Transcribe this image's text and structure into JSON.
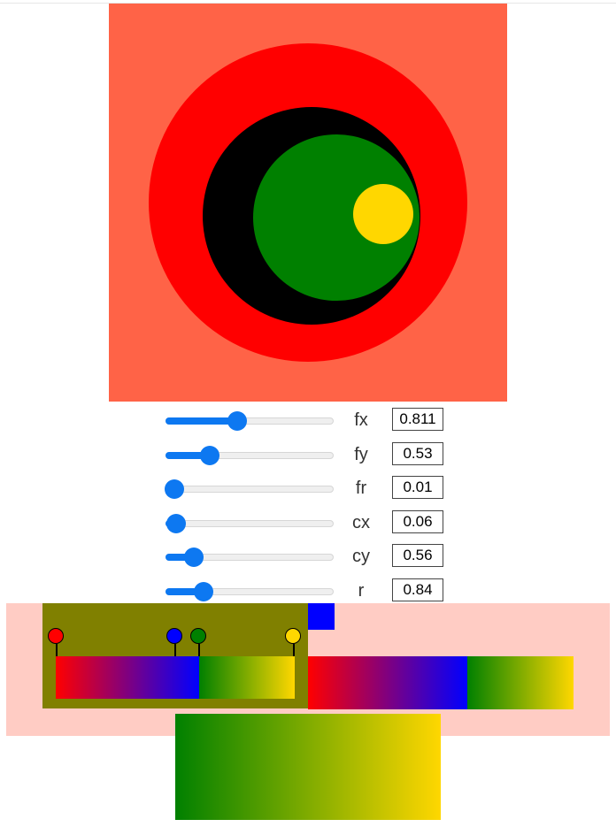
{
  "colors": {
    "background": "#ff6347",
    "ring_outer": "#ff0000",
    "ring_dark": "#000000",
    "ring_green": "#008000",
    "ring_gold": "#ffd700",
    "slider_accent": "#0d78f1",
    "editor_bg": "#ffccc4",
    "editor_panel": "#808000",
    "stop_red": "#ff0000",
    "stop_blue": "#0000ff",
    "stop_green": "#008000",
    "stop_yellow": "#ffd700"
  },
  "controls": [
    {
      "name": "fx",
      "label": "fx",
      "value": "0.811",
      "level": 0.41
    },
    {
      "name": "fy",
      "label": "fy",
      "value": "0.53",
      "level": 0.23
    },
    {
      "name": "fr",
      "label": "fr",
      "value": "0.01",
      "level": 0.0
    },
    {
      "name": "cx",
      "label": "cx",
      "value": "0.06",
      "level": 0.01
    },
    {
      "name": "cy",
      "label": "cy",
      "value": "0.56",
      "level": 0.13
    },
    {
      "name": "r",
      "label": "r",
      "value": "0.84",
      "level": 0.19
    }
  ],
  "gradient_stops": [
    {
      "color": "#ff0000",
      "offset": 0.0
    },
    {
      "color": "#0000ff",
      "offset": 0.5
    },
    {
      "color": "#008000",
      "offset": 0.6
    },
    {
      "color": "#ffd700",
      "offset": 1.0
    }
  ]
}
